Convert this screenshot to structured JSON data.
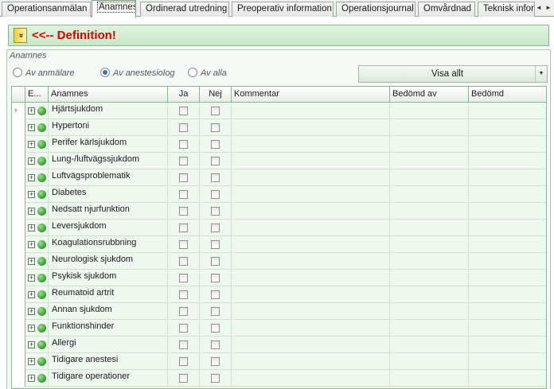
{
  "tabs": [
    {
      "label": "Operationsanmälan",
      "active": false
    },
    {
      "label": "Anamnes",
      "active": true
    },
    {
      "label": "Ordinerad utredning",
      "active": false
    },
    {
      "label": "Preoperativ information",
      "active": false
    },
    {
      "label": "Operationsjournal",
      "active": false
    },
    {
      "label": "Omvårdnad",
      "active": false
    },
    {
      "label": "Teknisk infor",
      "active": false
    }
  ],
  "tab_scroll": {
    "left_icon": "◄",
    "right_icon": "►"
  },
  "definition": {
    "toggle_icon": "»",
    "text": "<<-- Definition!",
    "color": "#dd0000"
  },
  "group": {
    "title": "Anamnes",
    "radios": [
      {
        "label": "Av anmälare",
        "selected": false
      },
      {
        "label": "Av anestesiolog",
        "selected": true
      },
      {
        "label": "Av alla",
        "selected": false
      }
    ],
    "visa_button": {
      "label": "Visa allt",
      "arrow_icon": "▼"
    }
  },
  "grid": {
    "headers": {
      "expand": "E...",
      "anamnes": "Anamnes",
      "ja": "Ja",
      "nej": "Nej",
      "kommentar": "Kommentar",
      "bedomd_av": "Bedömd av",
      "bedomd": "Bedömd"
    },
    "current_row_icon": "›",
    "expand_icon": "+",
    "status_color": "#2f9a2f",
    "rows": [
      {
        "name": "Hjärtsjukdom",
        "ja": false,
        "nej": false,
        "kommentar": "",
        "bedomd_av": "",
        "bedomd": ""
      },
      {
        "name": "Hypertoni",
        "ja": false,
        "nej": false,
        "kommentar": "",
        "bedomd_av": "",
        "bedomd": ""
      },
      {
        "name": "Perifer kärlsjukdom",
        "ja": false,
        "nej": false,
        "kommentar": "",
        "bedomd_av": "",
        "bedomd": ""
      },
      {
        "name": "Lung-/luftvägssjukdom",
        "ja": false,
        "nej": false,
        "kommentar": "",
        "bedomd_av": "",
        "bedomd": ""
      },
      {
        "name": "Luftvägsproblematik",
        "ja": false,
        "nej": false,
        "kommentar": "",
        "bedomd_av": "",
        "bedomd": ""
      },
      {
        "name": "Diabetes",
        "ja": false,
        "nej": false,
        "kommentar": "",
        "bedomd_av": "",
        "bedomd": ""
      },
      {
        "name": "Nedsatt njurfunktion",
        "ja": false,
        "nej": false,
        "kommentar": "",
        "bedomd_av": "",
        "bedomd": ""
      },
      {
        "name": "Leversjukdom",
        "ja": false,
        "nej": false,
        "kommentar": "",
        "bedomd_av": "",
        "bedomd": ""
      },
      {
        "name": "Koagulationsrubbning",
        "ja": false,
        "nej": false,
        "kommentar": "",
        "bedomd_av": "",
        "bedomd": ""
      },
      {
        "name": "Neurologisk sjukdom",
        "ja": false,
        "nej": false,
        "kommentar": "",
        "bedomd_av": "",
        "bedomd": ""
      },
      {
        "name": "Psykisk sjukdom",
        "ja": false,
        "nej": false,
        "kommentar": "",
        "bedomd_av": "",
        "bedomd": ""
      },
      {
        "name": "Reumatoid artrit",
        "ja": false,
        "nej": false,
        "kommentar": "",
        "bedomd_av": "",
        "bedomd": ""
      },
      {
        "name": "Annan sjukdom",
        "ja": false,
        "nej": false,
        "kommentar": "",
        "bedomd_av": "",
        "bedomd": ""
      },
      {
        "name": "Funktionshinder",
        "ja": false,
        "nej": false,
        "kommentar": "",
        "bedomd_av": "",
        "bedomd": ""
      },
      {
        "name": "Allergi",
        "ja": false,
        "nej": false,
        "kommentar": "",
        "bedomd_av": "",
        "bedomd": ""
      },
      {
        "name": "Tidigare anestesi",
        "ja": false,
        "nej": false,
        "kommentar": "",
        "bedomd_av": "",
        "bedomd": ""
      },
      {
        "name": "Tidigare operationer",
        "ja": false,
        "nej": false,
        "kommentar": "",
        "bedomd_av": "",
        "bedomd": ""
      }
    ]
  }
}
